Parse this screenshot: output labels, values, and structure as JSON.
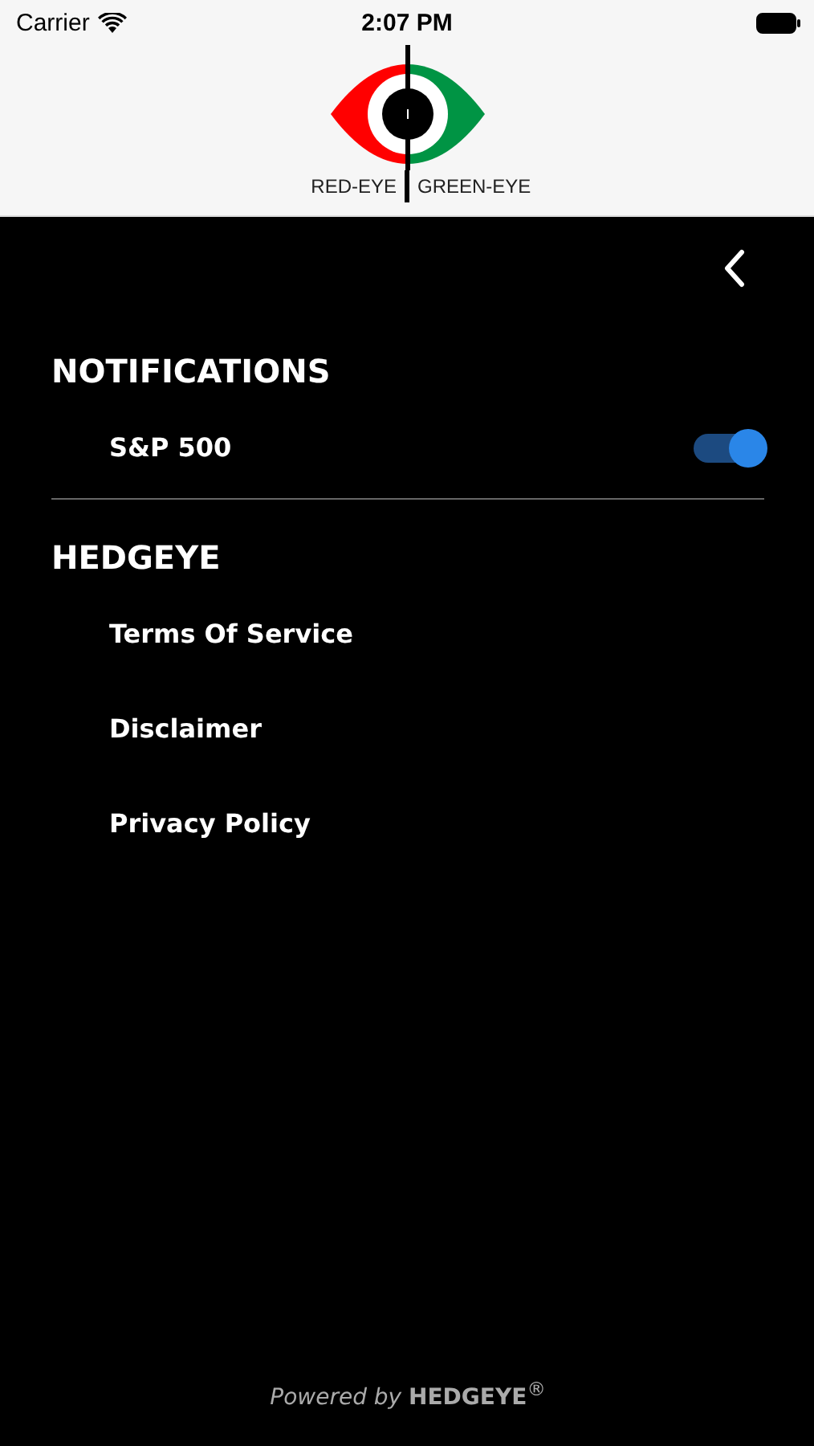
{
  "status_bar": {
    "carrier": "Carrier",
    "time": "2:07 PM"
  },
  "logo": {
    "left_label": "RED-EYE",
    "right_label": "GREEN-EYE"
  },
  "sections": [
    {
      "title": "NOTIFICATIONS",
      "items": [
        {
          "label": "S&P 500",
          "kind": "toggle",
          "on": true
        }
      ]
    },
    {
      "title": "HEDGEYE",
      "items": [
        {
          "label": "Terms Of Service",
          "kind": "link"
        },
        {
          "label": "Disclaimer",
          "kind": "link"
        },
        {
          "label": "Privacy Policy",
          "kind": "link"
        }
      ]
    }
  ],
  "footer": "*Powered by* **HEDGEYE**$^{®}$"
}
